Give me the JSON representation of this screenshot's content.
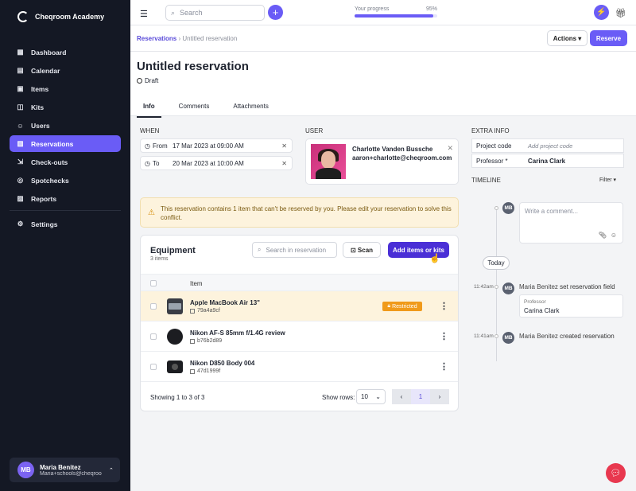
{
  "sidebar": {
    "brand": "Cheqroom Academy",
    "items": [
      {
        "label": "Dashboard",
        "icon": "dashboard-icon"
      },
      {
        "label": "Calendar",
        "icon": "calendar-icon"
      },
      {
        "label": "Items",
        "icon": "items-icon"
      },
      {
        "label": "Kits",
        "icon": "kits-icon"
      },
      {
        "label": "Users",
        "icon": "users-icon"
      },
      {
        "label": "Reservations",
        "icon": "reservations-icon",
        "active": true
      },
      {
        "label": "Check-outs",
        "icon": "checkouts-icon"
      },
      {
        "label": "Spotchecks",
        "icon": "spotchecks-icon"
      },
      {
        "label": "Reports",
        "icon": "reports-icon"
      },
      {
        "label": "Settings",
        "icon": "settings-icon"
      }
    ],
    "user": {
      "initials": "MB",
      "name": "Maria Benitez",
      "email": "Maria+schools@cheqroo..."
    }
  },
  "topbar": {
    "search_placeholder": "Search",
    "progress_label": "Your progress",
    "progress_value": "95%",
    "progress_fraction": 0.95
  },
  "breadcrumb": {
    "root": "Reservations",
    "current": "Untitled reservation"
  },
  "buttons": {
    "actions": "Actions",
    "reserve": "Reserve"
  },
  "page": {
    "title": "Untitled reservation",
    "status": "Draft"
  },
  "tabs": [
    "Info",
    "Comments",
    "Attachments"
  ],
  "when": {
    "label": "WHEN",
    "from_label": "From",
    "from_value": "17 Mar 2023 at 09:00 AM",
    "to_label": "To",
    "to_value": "20 Mar 2023 at 10:00 AM"
  },
  "user_section": {
    "label": "USER",
    "name": "Charlotte Vanden Bussche",
    "email": "aaron+charlotte@cheqroom.com"
  },
  "extra": {
    "label": "EXTRA INFO",
    "project_code_label": "Project code",
    "project_code_placeholder": "Add project code",
    "professor_label": "Professor *",
    "professor_value": "Carina Clark"
  },
  "alert": {
    "text": "This reservation contains 1 item that can't be reserved by you. Please edit your reservation to solve this conflict."
  },
  "equipment": {
    "title": "Equipment",
    "count": "3 items",
    "search_placeholder": "Search in reservation",
    "scan": "Scan",
    "add": "Add items or kits",
    "column": "Item",
    "rows": [
      {
        "name": "Apple MacBook Air 13\"",
        "id": "79a4a9cf",
        "badge": "Restricted"
      },
      {
        "name": "Nikon AF-S 85mm f/1.4G review",
        "id": "b76b2d89",
        "badge": ""
      },
      {
        "name": "Nikon D850 Body 004",
        "id": "47d1999f",
        "badge": ""
      }
    ],
    "showing": "Showing 1 to 3 of 3",
    "show_rows_label": "Show rows:",
    "show_rows_value": "10",
    "page": "1"
  },
  "timeline": {
    "label": "TIMELINE",
    "filter": "Filter",
    "comment_placeholder": "Write a comment...",
    "today": "Today",
    "events": [
      {
        "time": "11:42am",
        "actor": "Maria Benitez",
        "action": "set reservation field",
        "field_label": "Professor",
        "field_value": "Carina Clark"
      },
      {
        "time": "11:41am",
        "actor": "Maria Benitez",
        "action": "created reservation"
      }
    ],
    "initials": "MB"
  }
}
